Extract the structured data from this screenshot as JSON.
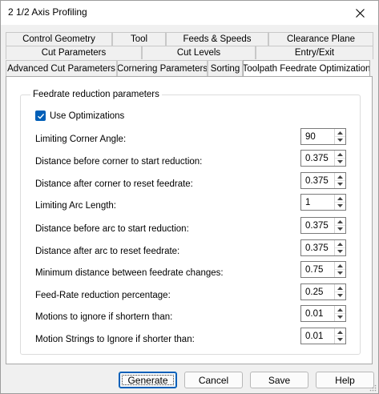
{
  "window": {
    "title": "2 1/2 Axis Profiling"
  },
  "tabs": [
    {
      "label": "Control Geometry"
    },
    {
      "label": "Tool"
    },
    {
      "label": "Feeds & Speeds"
    },
    {
      "label": "Clearance Plane"
    },
    {
      "label": "Cut Parameters"
    },
    {
      "label": "Cut Levels"
    },
    {
      "label": "Entry/Exit"
    },
    {
      "label": "Advanced Cut Parameters"
    },
    {
      "label": "Cornering Parameters"
    },
    {
      "label": "Sorting"
    },
    {
      "label": "Toolpath Feedrate Optimization"
    }
  ],
  "group": {
    "legend": "Feedrate reduction parameters",
    "use_optimizations": {
      "label": "Use Optimizations",
      "checked": true
    }
  },
  "params": [
    {
      "label": "Limiting Corner Angle:",
      "value": "90"
    },
    {
      "label": "Distance before corner to start reduction:",
      "value": "0.375"
    },
    {
      "label": "Distance after corner to reset feedrate:",
      "value": "0.375"
    },
    {
      "label": "Limiting Arc Length:",
      "value": "1"
    },
    {
      "label": "Distance before arc to start reduction:",
      "value": "0.375"
    },
    {
      "label": "Distance after arc to reset feedrate:",
      "value": "0.375"
    },
    {
      "label": "Minimum distance between feedrate changes:",
      "value": "0.75"
    },
    {
      "label": "Feed-Rate reduction percentage:",
      "value": "0.25"
    },
    {
      "label": "Motions to ignore if shortern than:",
      "value": "0.01"
    },
    {
      "label": "Motion Strings to Ignore if shorter than:",
      "value": "0.01"
    }
  ],
  "buttons": {
    "generate": "Generate",
    "cancel": "Cancel",
    "save": "Save",
    "help": "Help"
  },
  "colors": {
    "accent": "#005fb8"
  }
}
